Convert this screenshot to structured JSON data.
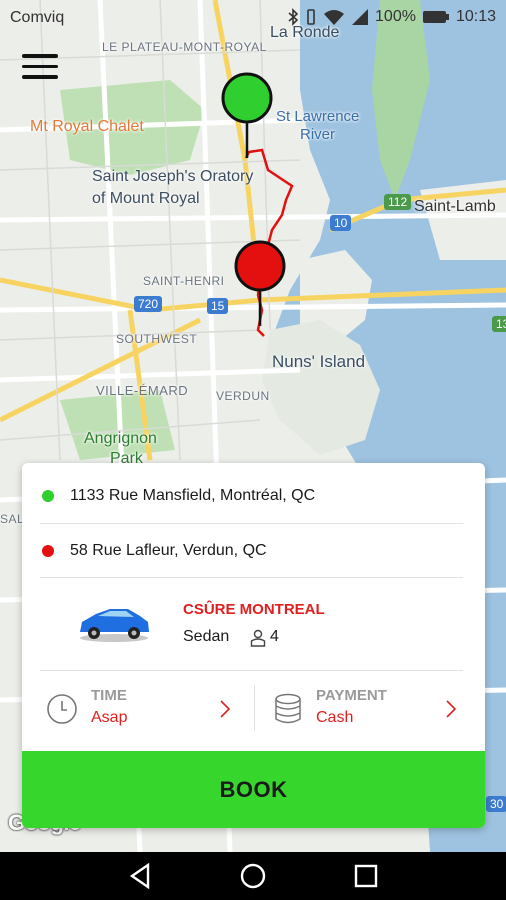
{
  "status_bar": {
    "carrier": "Comviq",
    "battery": "100%",
    "time": "10:13"
  },
  "map": {
    "labels": {
      "le_plateau": "LE PLATEAU-MONT-ROYAL",
      "la_ronde": "La Ronde",
      "mt_royal_chalet": "Mt Royal Chalet",
      "st_lawrence_1": "St Lawrence",
      "st_lawrence_2": "River",
      "saint_joseph_1": "Saint Joseph's Oratory",
      "saint_joseph_2": "of Mount Royal",
      "saint_henri": "SAINT-HENRI",
      "saint_lambert": "Saint-Lamb",
      "nuns_island": "Nuns' Island",
      "southwest": "SOUTHWEST",
      "ville_emard": "VILLE-ÉMARD",
      "verdun": "VERDUN",
      "angrignon_1": "Angrignon",
      "angrignon_2": "Park",
      "sal": "SAL",
      "shield_720": "720",
      "shield_15": "15",
      "shield_10": "10",
      "shield_112": "112",
      "shield_13": "13",
      "shield_30": "30"
    },
    "google_logo": "Google"
  },
  "menu_icon": "menu-icon",
  "booking": {
    "pickup": {
      "address": "1133 Rue Mansfield, Montréal, QC",
      "dot_color": "#2fcf2f"
    },
    "dropoff": {
      "address": "58 Rue Lafleur, Verdun, QC",
      "dot_color": "#e41010"
    },
    "vehicle": {
      "company": "CSÛRE MONTREAL",
      "type": "Sedan",
      "seats": "4"
    },
    "time": {
      "label": "TIME",
      "value": "Asap"
    },
    "payment": {
      "label": "PAYMENT",
      "value": "Cash"
    },
    "book_label": "BOOK"
  },
  "colors": {
    "accent_red": "#e02020",
    "book_green": "#37d62d",
    "pickup_green": "#2fcf2f",
    "dropoff_red": "#e41010"
  }
}
